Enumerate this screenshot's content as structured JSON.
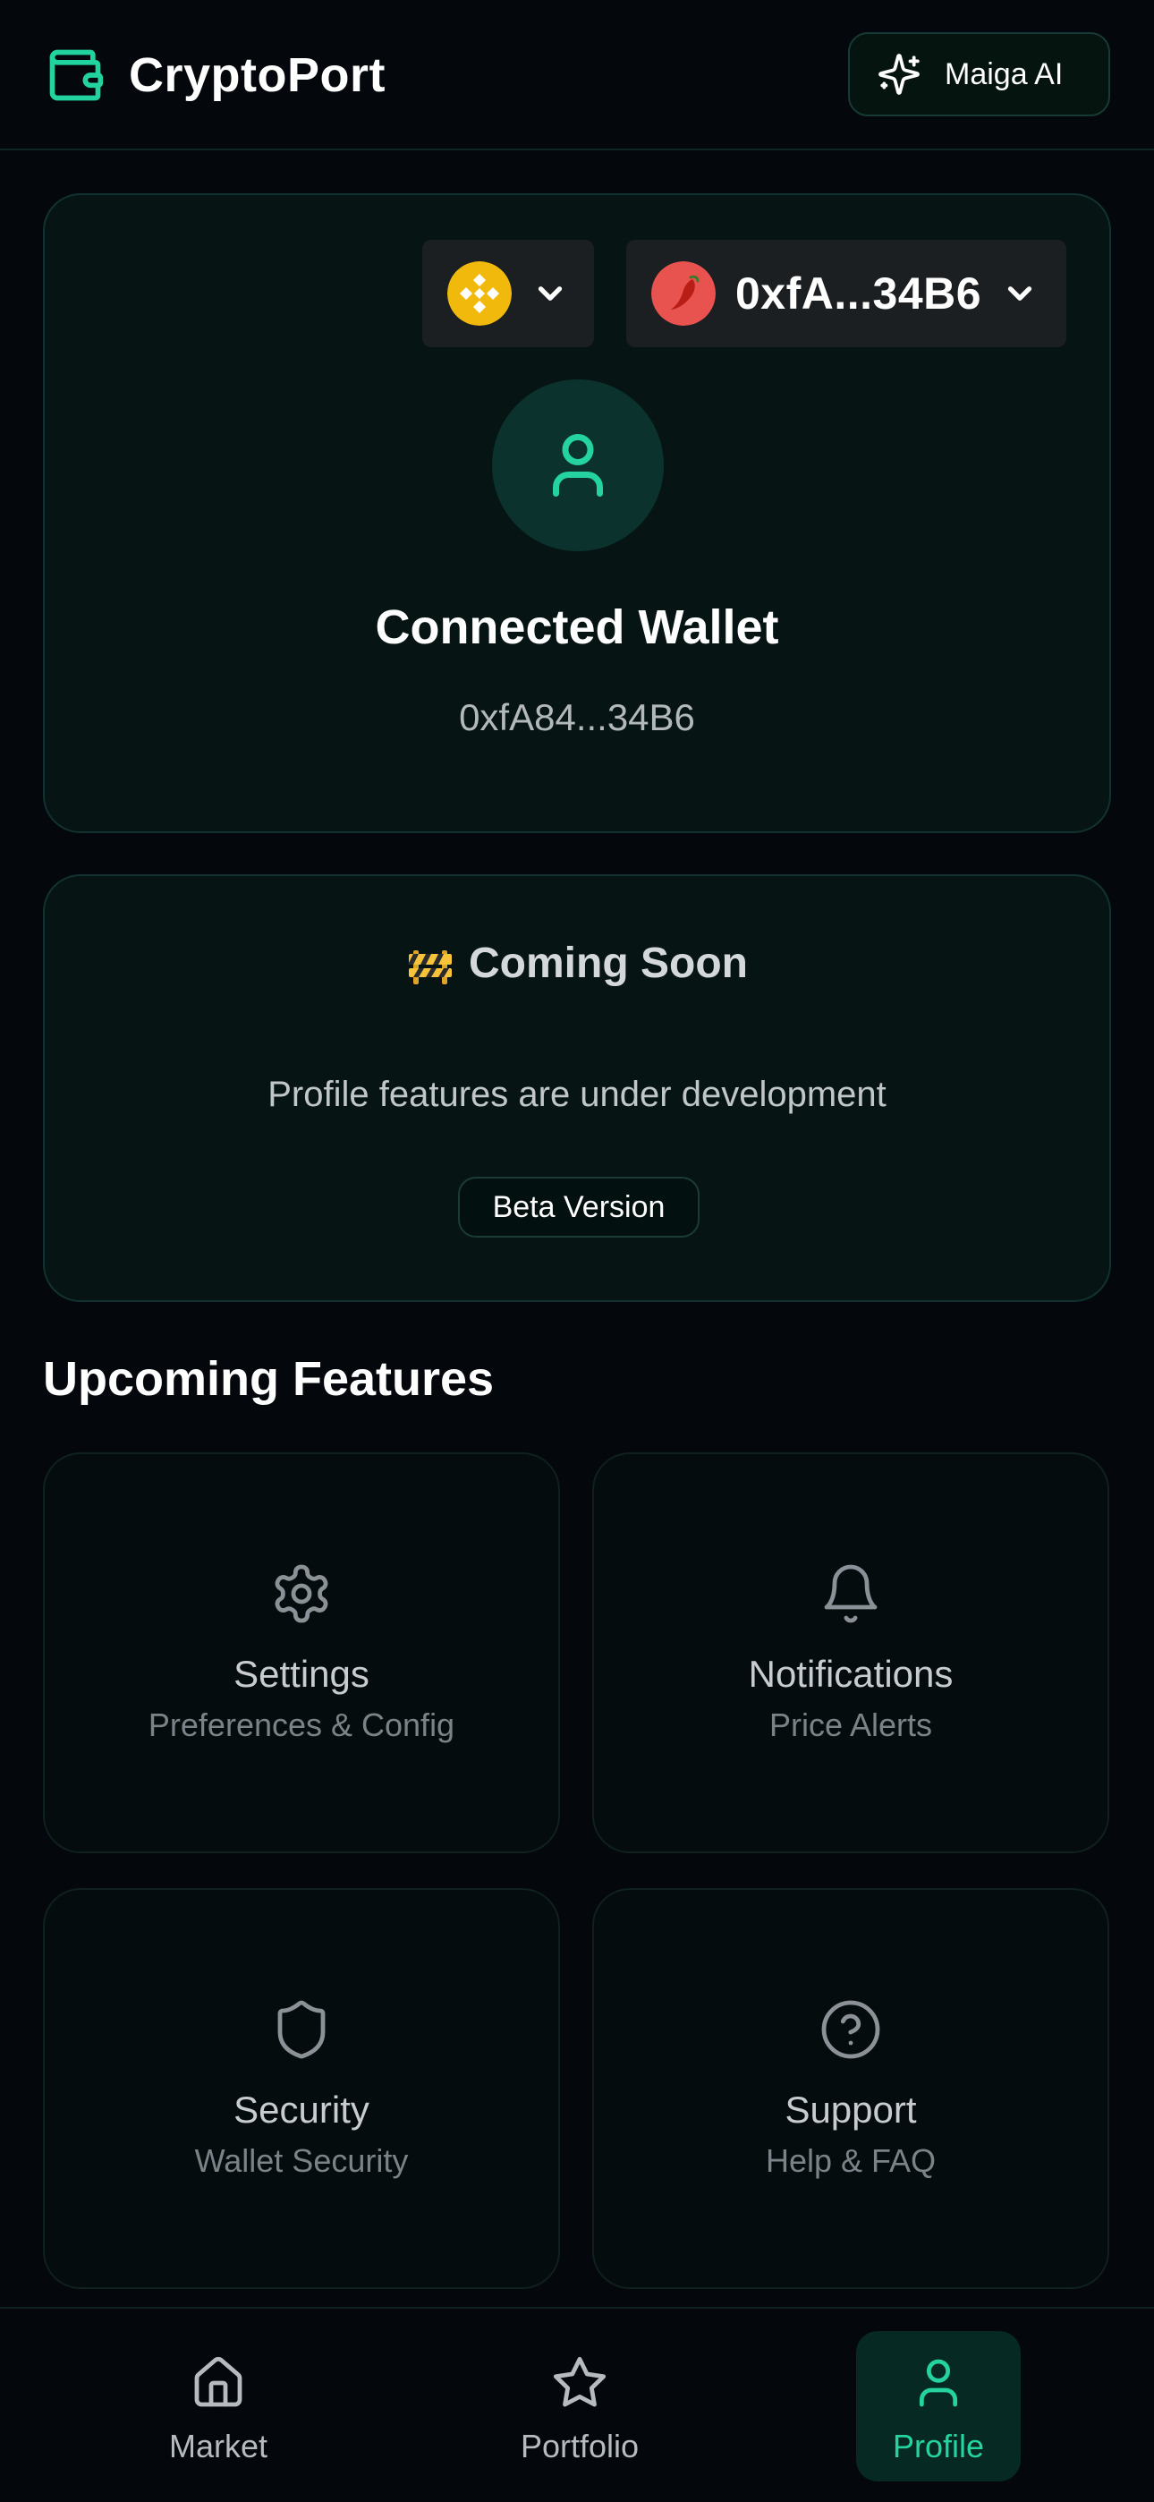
{
  "header": {
    "app_title": "CryptoPort",
    "logo_icon": "wallet-icon",
    "ai_button_label": "Maiga AI",
    "ai_button_icon": "sparkles-icon"
  },
  "wallet": {
    "chain_icon": "bnb-chain-icon",
    "address_short": "0xfA...34B6",
    "address_icon": "chili-pepper-icon",
    "avatar_icon": "user-icon",
    "title": "Connected Wallet",
    "address_display": "0xfA84...34B6"
  },
  "coming_soon": {
    "icon": "construction-barrier-icon",
    "title": "Coming Soon",
    "description": "Profile features are under development",
    "badge": "Beta Version"
  },
  "upcoming": {
    "section_title": "Upcoming Features",
    "features": [
      {
        "icon": "gear-icon",
        "name": "Settings",
        "description": "Preferences & Config"
      },
      {
        "icon": "bell-icon",
        "name": "Notifications",
        "description": "Price Alerts"
      },
      {
        "icon": "shield-icon",
        "name": "Security",
        "description": "Wallet Security"
      },
      {
        "icon": "question-circle-icon",
        "name": "Support",
        "description": "Help & FAQ"
      }
    ]
  },
  "nav": {
    "active": "Profile",
    "items": [
      {
        "label": "Market",
        "icon": "home-icon"
      },
      {
        "label": "Portfolio",
        "icon": "star-icon"
      },
      {
        "label": "Profile",
        "icon": "user-icon"
      }
    ]
  },
  "colors": {
    "background": "#04070b",
    "accent": "#25d3a0",
    "card": "#061514",
    "bnb_yellow": "#f0b90b",
    "avatar_red": "#e9534f"
  }
}
